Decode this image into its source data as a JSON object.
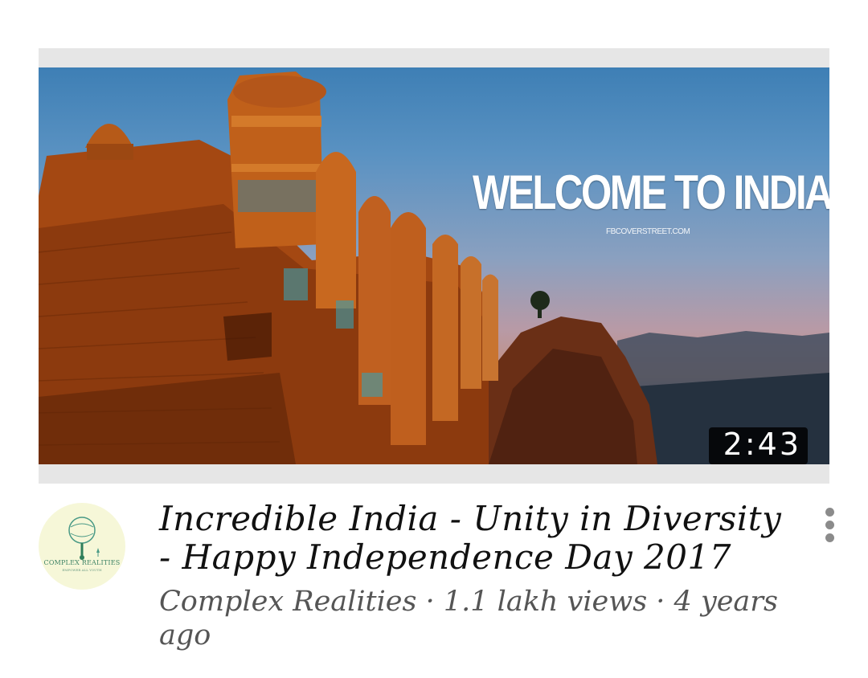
{
  "video": {
    "thumbnail_headline": "WELCOME TO INDIA!",
    "thumbnail_watermark": "FBCOVERSTREET.COM",
    "duration": "2:43",
    "title": "Incredible India - Unity in Diversity - Happy Independence Day 2017",
    "channel": "Complex Realities",
    "views": "1.1 lakh views",
    "age": "4 years ago",
    "subtitle": "Complex Realities · 1.1 lakh views · 4 years ago"
  },
  "channel_avatar": {
    "logo_text": "COMPLEX REALITIES",
    "logo_tagline": "EMPOWER ALL YOUTH"
  },
  "icons": {
    "more": "more-vertical-icon"
  }
}
